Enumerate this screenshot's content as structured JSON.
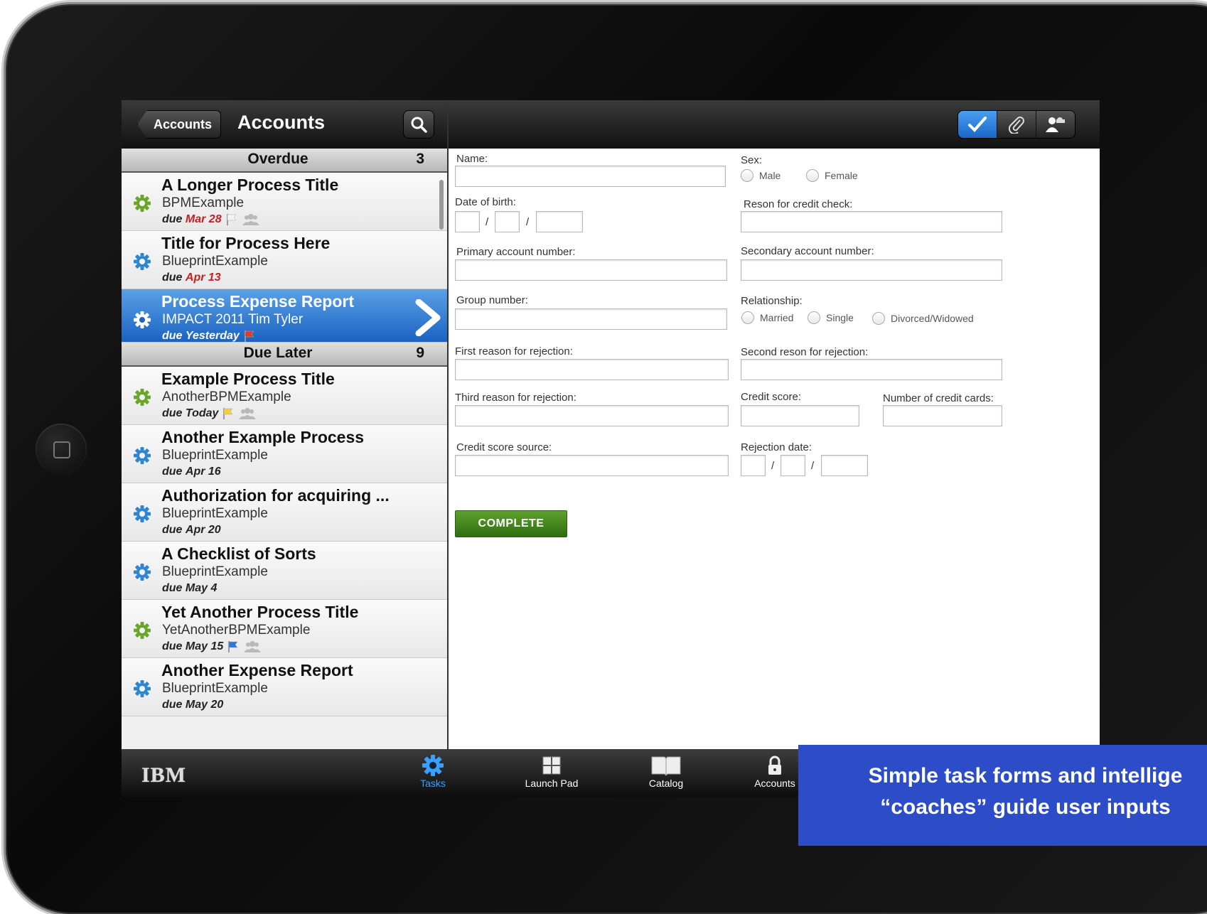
{
  "left_pane": {
    "back_label": "Accounts",
    "title": "Accounts",
    "sections": [
      {
        "title": "Overdue",
        "count": "3"
      },
      {
        "title": "Due Later",
        "count": "9"
      }
    ],
    "items": [
      {
        "title": "A Longer Process Title",
        "sub": "BPMExample",
        "due_prefix": "due",
        "due_date": "Mar 28",
        "gear": "green",
        "flag": "white",
        "group": true,
        "overdue": true,
        "selected": false
      },
      {
        "title": "Title for Process Here",
        "sub": "BlueprintExample",
        "due_prefix": "due",
        "due_date": "Apr 13",
        "gear": "blue",
        "flag": "",
        "group": false,
        "overdue": true,
        "selected": false
      },
      {
        "title": "Process Expense Report",
        "sub": "IMPACT 2011 Tim Tyler",
        "due_prefix": "due",
        "due_date": "Yesterday",
        "gear": "white",
        "flag": "red",
        "group": false,
        "overdue": false,
        "selected": true
      },
      {
        "title": "Example Process Title",
        "sub": "AnotherBPMExample",
        "due_prefix": "due",
        "due_date": "Today",
        "gear": "green",
        "flag": "yellow",
        "group": true,
        "overdue": false,
        "selected": false
      },
      {
        "title": "Another Example Process",
        "sub": "BlueprintExample",
        "due_prefix": "due",
        "due_date": "Apr 16",
        "gear": "blue",
        "flag": "",
        "group": false,
        "overdue": false,
        "selected": false
      },
      {
        "title": "Authorization for acquiring ...",
        "sub": "BlueprintExample",
        "due_prefix": "due",
        "due_date": "Apr 20",
        "gear": "blue",
        "flag": "",
        "group": false,
        "overdue": false,
        "selected": false
      },
      {
        "title": "A Checklist of Sorts",
        "sub": "BlueprintExample",
        "due_prefix": "due",
        "due_date": "May 4",
        "gear": "blue",
        "flag": "",
        "group": false,
        "overdue": false,
        "selected": false
      },
      {
        "title": "Yet Another Process Title",
        "sub": "YetAnotherBPMExample",
        "due_prefix": "due",
        "due_date": "May 15",
        "gear": "green",
        "flag": "blue",
        "group": true,
        "overdue": false,
        "selected": false
      },
      {
        "title": "Another Expense Report",
        "sub": "BlueprintExample",
        "due_prefix": "due",
        "due_date": "May 20",
        "gear": "blue",
        "flag": "",
        "group": false,
        "overdue": false,
        "selected": false
      }
    ]
  },
  "form": {
    "name_label": "Name:",
    "sex_label": "Sex:",
    "sex_options": [
      "Male",
      "Female"
    ],
    "dob_label": "Date of birth:",
    "credit_reason_label": "Reson for credit check:",
    "primary_label": "Primary account number:",
    "secondary_label": "Secondary account number:",
    "group_label": "Group number:",
    "relationship_label": "Relationship:",
    "relationship_options": [
      "Married",
      "Single",
      "Divorced/Widowed"
    ],
    "first_reject_label": "First reason for rejection:",
    "second_reject_label": "Second reson for rejection:",
    "third_reject_label": "Third reason for rejection:",
    "credit_score_label": "Credit score:",
    "num_cards_label": "Number of credit cards:",
    "score_source_label": "Credit score source:",
    "rejection_date_label": "Rejection date:",
    "date_sep": "/",
    "complete_label": "COMPLETE"
  },
  "tabbar": {
    "logo": "IBM",
    "tabs": [
      {
        "label": "Tasks",
        "icon": "gear-icon",
        "active": true
      },
      {
        "label": "Launch Pad",
        "icon": "grid-icon",
        "active": false
      },
      {
        "label": "Catalog",
        "icon": "book-icon",
        "active": false
      },
      {
        "label": "Accounts",
        "icon": "lock-icon",
        "active": false
      }
    ]
  },
  "caption": {
    "line1": "Simple task forms and intellige",
    "line2": "“coaches” guide user inputs"
  },
  "colors": {
    "selected_row": "#1a63c2",
    "complete_button": "#4a8a1f",
    "caption_bg": "#2c4dc7",
    "overdue_text": "#c42121",
    "active_tab": "#3aa0ff"
  }
}
